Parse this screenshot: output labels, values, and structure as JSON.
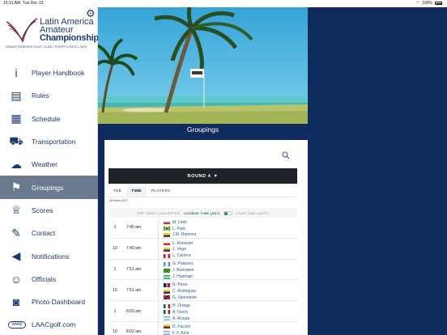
{
  "status": {
    "time": "10:21 AM",
    "date": "Tue Dec 13",
    "battery": "100%"
  },
  "logo": {
    "line1": "Latin America",
    "line2": "Amateur",
    "line3": "Championship",
    "sub": "GRAND RESERVE GOLF CLUB • PUERTO RICO • 2023"
  },
  "nav": [
    {
      "label": "Player Handbook",
      "icon": "info-icon",
      "glyph": "i"
    },
    {
      "label": "Rules",
      "icon": "document-icon",
      "glyph": "▤"
    },
    {
      "label": "Schedule",
      "icon": "calendar-icon",
      "glyph": "▦"
    },
    {
      "label": "Transportation",
      "icon": "car-icon",
      "glyph": "⛟"
    },
    {
      "label": "Weather",
      "icon": "weather-icon",
      "glyph": "☁"
    },
    {
      "label": "Groupings",
      "icon": "flag-icon",
      "glyph": "⚑"
    },
    {
      "label": "Scores",
      "icon": "trophy-icon",
      "glyph": "♕"
    },
    {
      "label": "Contact",
      "icon": "pencil-icon",
      "glyph": "✎"
    },
    {
      "label": "Notifications",
      "icon": "speaker-icon",
      "glyph": "◀"
    },
    {
      "label": "Officials",
      "icon": "people-icon",
      "glyph": "☺"
    },
    {
      "label": "Photo Dashboard",
      "icon": "camera-icon",
      "glyph": "◙"
    },
    {
      "label": "LAACgolf.com",
      "icon": "www-icon",
      "glyph": "www"
    }
  ],
  "page_title": "Groupings",
  "round_label": "ROUND 4",
  "tabs": [
    "TEE",
    "TIME",
    "PLAYERS"
  ],
  "tee_note": "All times AST",
  "converter": {
    "label": "TEE TIMES CONVERTER:",
    "course": "COURSE TIME (AST)",
    "yours": "YOUR TIME (AEST)"
  },
  "groups": [
    {
      "tee": "1",
      "time": "7:40 am",
      "players": [
        {
          "name": "M. León",
          "flag": "chile"
        },
        {
          "name": "L. Park",
          "flag": "brazil"
        },
        {
          "name": "J.M. Ramirez",
          "flag": "colombia"
        }
      ]
    },
    {
      "tee": "10",
      "time": "7:40 am",
      "players": [
        {
          "name": "L. Roessler",
          "flag": "chile"
        },
        {
          "name": "J. Vega",
          "flag": "colombia"
        },
        {
          "name": "L. Carrera",
          "flag": "peru"
        }
      ]
    },
    {
      "tee": "1",
      "time": "7:51 am",
      "players": [
        {
          "name": "G. Palacios",
          "flag": "guatemala"
        },
        {
          "name": "J. Burrowes",
          "flag": "jamaica"
        },
        {
          "name": "J. Hastings",
          "flag": "bahamas"
        }
      ]
    },
    {
      "tee": "10",
      "time": "7:51 am",
      "players": [
        {
          "name": "R. Pena",
          "flag": "dominican"
        },
        {
          "name": "C. Rodriguez",
          "flag": "colombia"
        },
        {
          "name": "G. Vanoosste",
          "flag": "trinidad"
        }
      ]
    },
    {
      "tee": "1",
      "time": "8:02 am",
      "players": [
        {
          "name": "H. Ortega",
          "flag": "mexico"
        },
        {
          "name": "A. Fierro",
          "flag": "mexico"
        },
        {
          "name": "A. Acosta",
          "flag": "argentina"
        }
      ]
    },
    {
      "tee": "10",
      "time": "8:02 am",
      "players": [
        {
          "name": "D. Faccini",
          "flag": "colombia"
        },
        {
          "name": "F. F. Arce",
          "flag": "argentina"
        }
      ]
    }
  ]
}
